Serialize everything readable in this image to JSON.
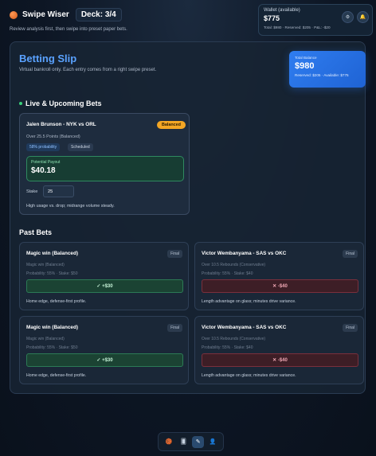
{
  "header": {
    "app_title": "Swipe Wiser",
    "deck_label": "Deck: 3/4",
    "subtitle": "Review analysis first, then swipe into preset paper bets."
  },
  "wallet": {
    "title": "Wallet (available)",
    "amount": "$775",
    "detail": "Total: $980 · Reserved: $205 · P&L: -$20",
    "gear_icon": "⚙",
    "bell_icon": "🔔"
  },
  "slip": {
    "title": "Betting Slip",
    "subtitle": "Virtual bankroll only. Each entry comes from a right swipe preset."
  },
  "total_balance": {
    "label": "Total Balance",
    "amount": "$980",
    "detail": "Reserved: $205 · Available: $775"
  },
  "live": {
    "heading": "Live & Upcoming Bets",
    "card": {
      "title": "Jalen Brunson - NYK vs ORL",
      "badge": "Balanced",
      "line": "Over 25.5 Points (Balanced)",
      "probability": "58% probability",
      "status": "Scheduled",
      "payout_label": "Potential Payout",
      "payout_amount": "$40.18",
      "stake_label": "Stake",
      "stake_value": "25",
      "note": "High usage vs. drop; midrange volume steady."
    }
  },
  "past": {
    "heading": "Past Bets",
    "items": [
      {
        "title": "Magic win (Balanced)",
        "status": "Final",
        "line": "Magic win (Balanced)",
        "meta": "Probability: 55% · Stake: $50",
        "result": "✓ +$30",
        "outcome": "win",
        "note": "Home edge, defense-first profile."
      },
      {
        "title": "Victor Wembanyama - SAS vs OKC",
        "status": "Final",
        "line": "Over 10.5 Rebounds (Conservative)",
        "meta": "Probability: 55% · Stake: $40",
        "result": "✕ -$40",
        "outcome": "loss",
        "note": "Length advantage on glass; minutes drive variance."
      },
      {
        "title": "Magic win (Balanced)",
        "status": "Final",
        "line": "Magic win (Balanced)",
        "meta": "Probability: 55% · Stake: $50",
        "result": "✓ +$30",
        "outcome": "win",
        "note": "Home edge, defense-first profile."
      },
      {
        "title": "Victor Wembanyama - SAS vs OKC",
        "status": "Final",
        "line": "Over 10.5 Rebounds (Conservative)",
        "meta": "Probability: 55% · Stake: $40",
        "result": "✕ -$40",
        "outcome": "loss",
        "note": "Length advantage on glass; minutes drive variance."
      }
    ]
  },
  "nav": {
    "items": [
      {
        "icon": "basketball-icon",
        "glyph": "🏀"
      },
      {
        "icon": "cards-icon",
        "glyph": "🂠"
      },
      {
        "icon": "pencil-icon",
        "glyph": "✎"
      },
      {
        "icon": "user-icon",
        "glyph": "👤"
      }
    ],
    "active_index": 2
  },
  "colors": {
    "accent": "#5aa2ff",
    "balanced_badge": "#f3a624",
    "win": "#2c7a55",
    "loss": "#7a2f3c"
  }
}
